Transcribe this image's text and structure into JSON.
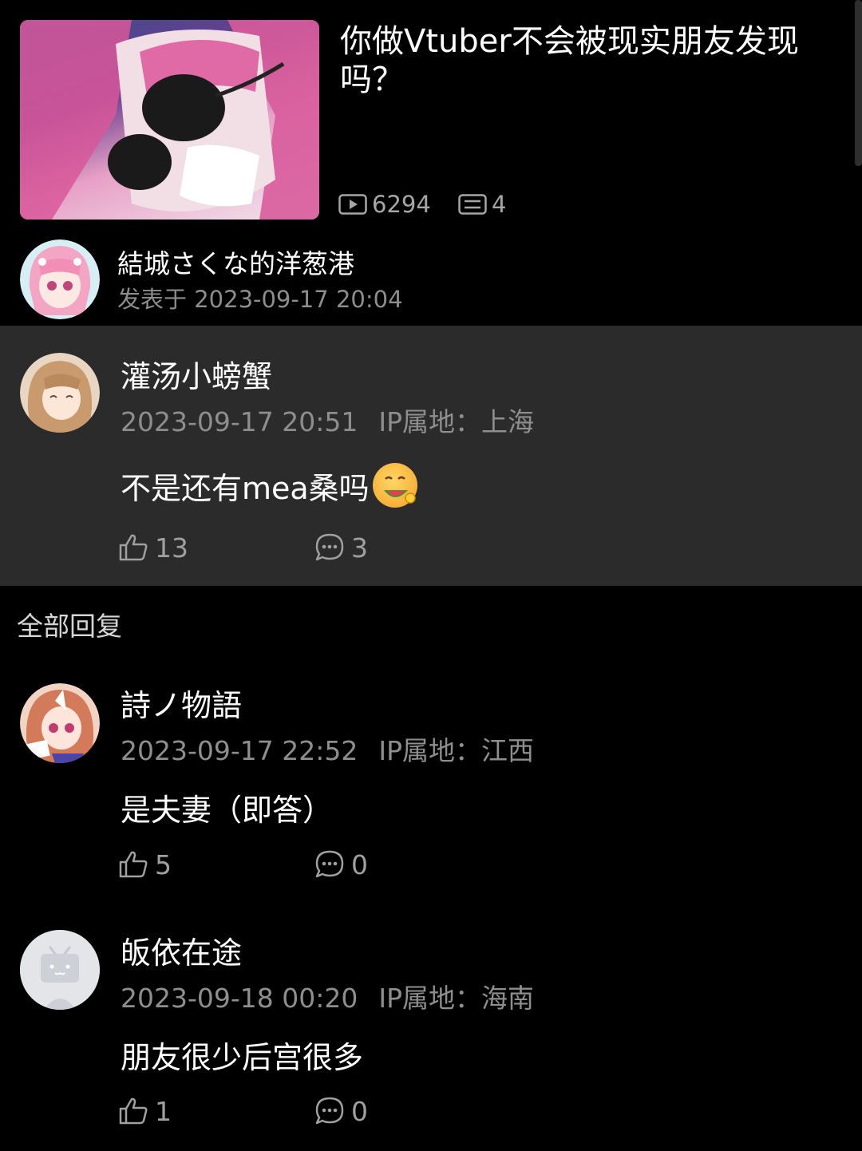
{
  "post": {
    "title": "你做Vtuber不会被现实朋友发现吗？",
    "views": "6294",
    "comments": "4"
  },
  "author": {
    "name": "結城さくな的洋葱港",
    "meta": "发表于 2023-09-17 20:04"
  },
  "main_comment": {
    "name": "灌汤小螃蟹",
    "time": "2023-09-17 20:51",
    "ip": "IP属地：上海",
    "text": "不是还有mea桑吗",
    "likes": "13",
    "replies": "3"
  },
  "replies_header": "全部回复",
  "replies": [
    {
      "name": "詩ノ物語",
      "time": "2023-09-17 22:52",
      "ip": "IP属地：江西",
      "text": "是夫妻（即答）",
      "likes": "5",
      "replies": "0"
    },
    {
      "name": "皈依在途",
      "time": "2023-09-18 00:20",
      "ip": "IP属地：海南",
      "text": "朋友很少后宫很多",
      "likes": "1",
      "replies": "0"
    }
  ],
  "icons": {
    "views": "play-icon",
    "comments": "comment-list-icon",
    "like": "thumbs-up-icon",
    "reply": "chat-bubble-icon"
  }
}
